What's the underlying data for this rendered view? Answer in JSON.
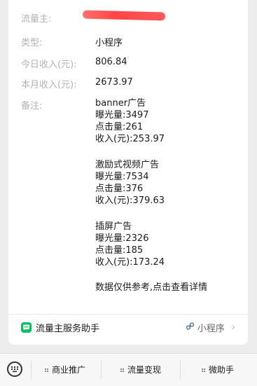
{
  "info": {
    "owner_label": "流量主:",
    "type_label": "类型:",
    "type_value": "小程序",
    "today_label": "今日收入(元):",
    "today_value": "806.84",
    "month_label": "本月收入(元):",
    "month_value": "2673.97",
    "note_label": "备注:"
  },
  "notes": {
    "banner": {
      "title": "banner广告",
      "exposure": "曝光量:3497",
      "clicks": "点击量:261",
      "income": "收入(元):253.97"
    },
    "rewarded": {
      "title": "激励式视频广告",
      "exposure": "曝光量:7534",
      "clicks": "点击量:376",
      "income": "收入(元):379.63"
    },
    "interstitial": {
      "title": "插屏广告",
      "exposure": "曝光量:2326",
      "clicks": "点击量:185",
      "income": "收入(元):173.24"
    },
    "footer_note": "数据仅供参考,点击查看详情"
  },
  "footer": {
    "left_label": "流量主服务助手",
    "right_label": "小程序"
  },
  "menu": {
    "items": [
      "商业推广",
      "流量变现",
      "微助手"
    ]
  },
  "icons": {
    "service": "wechat-service-icon",
    "mini_program": "mini-program-icon",
    "keyboard": "keyboard-icon",
    "chevron": "chevron-right-icon"
  }
}
